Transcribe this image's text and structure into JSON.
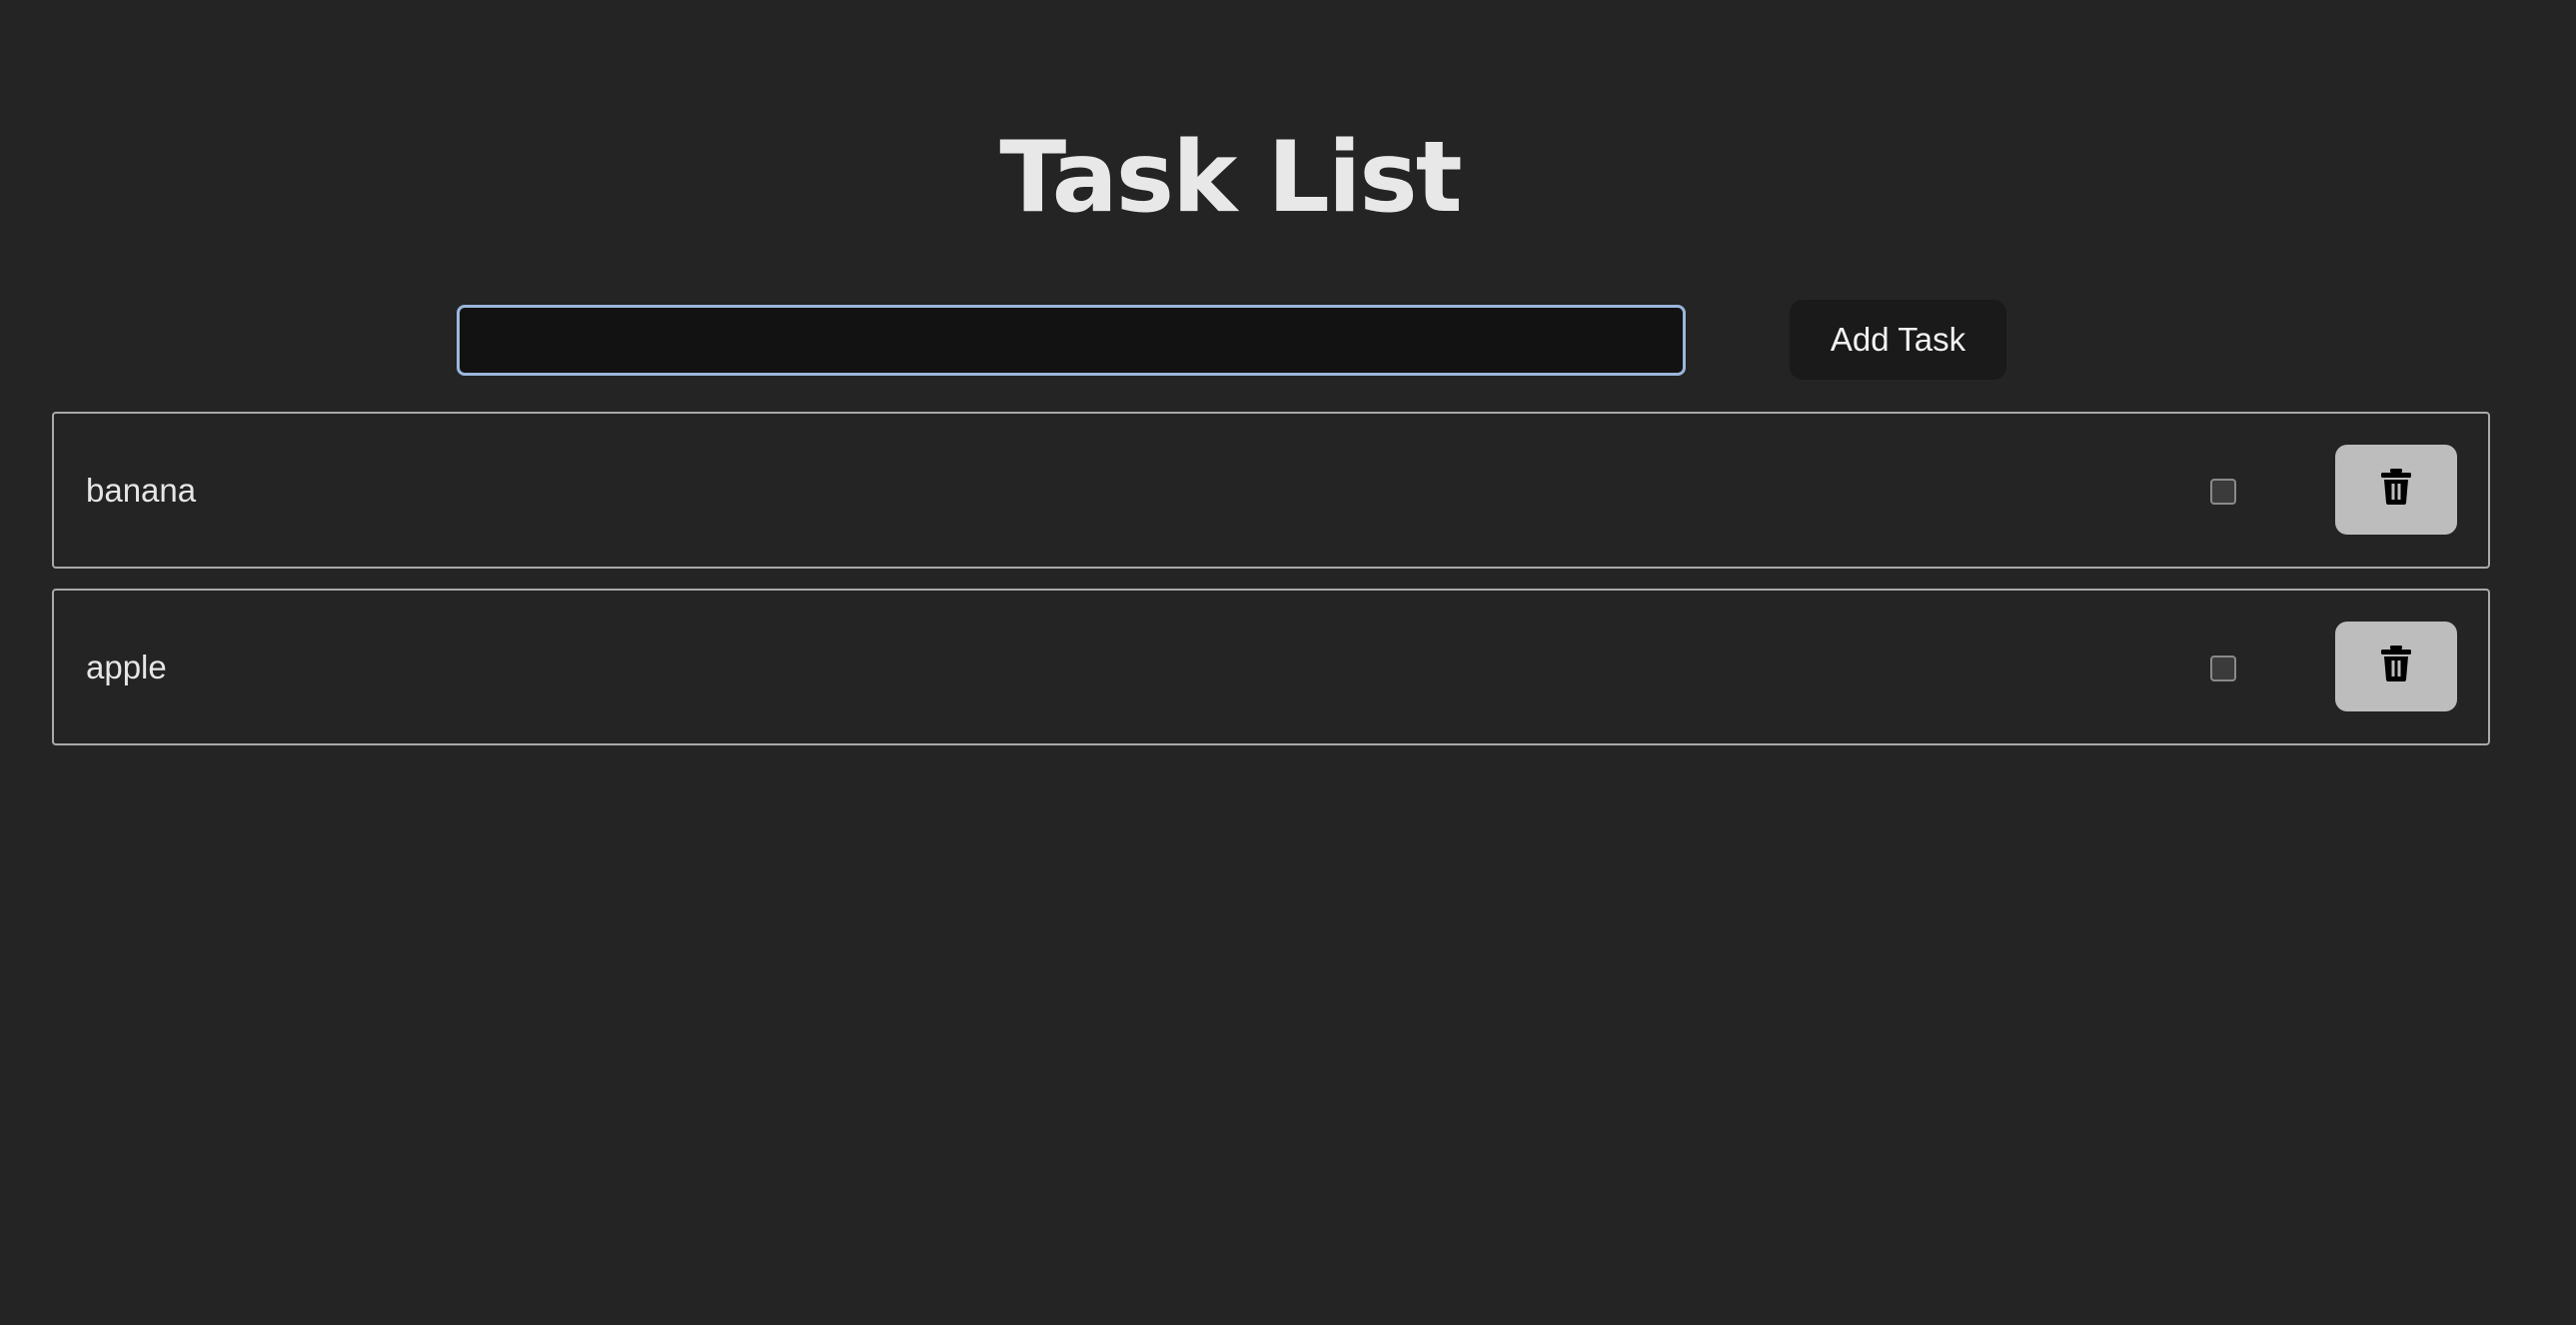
{
  "header": {
    "title": "Task List"
  },
  "form": {
    "input_value": "",
    "input_placeholder": "",
    "add_button_label": "Add Task"
  },
  "tasks": [
    {
      "text": "banana",
      "completed": false,
      "delete_icon": "trash-icon"
    },
    {
      "text": "apple",
      "completed": false,
      "delete_icon": "trash-icon"
    }
  ],
  "colors": {
    "background": "#242424",
    "input_focus_border": "#9bb6dc",
    "delete_button": "#bdbdbd"
  }
}
